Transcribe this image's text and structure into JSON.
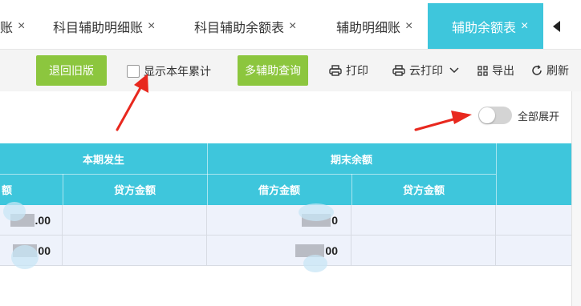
{
  "tabs": [
    {
      "label": "账",
      "close": "×"
    },
    {
      "label": "科目辅助明细账",
      "close": "×"
    },
    {
      "label": "科目辅助余额表",
      "close": "×"
    },
    {
      "label": "辅助明细账",
      "close": "×"
    },
    {
      "label": "辅助余额表",
      "close": "×",
      "active": true
    }
  ],
  "toolbar": {
    "back_label": "退回旧版",
    "show_cumulative_label": "显示本年累计",
    "multi_query_label": "多辅助查询",
    "print_label": "打印",
    "cloud_print_label": "云打印",
    "export_label": "导出",
    "refresh_label": "刷新"
  },
  "expand_all_label": "全部展开",
  "table": {
    "group_headers": {
      "current_period": "本期发生",
      "closing_balance": "期末余额"
    },
    "sub_headers": {
      "debit_partial": "额",
      "current_credit": "贷方金额",
      "closing_debit": "借方金额",
      "closing_credit": "贷方金额"
    },
    "rows": [
      {
        "current_debit_suffix": ".00",
        "closing_debit_suffix": "0"
      },
      {
        "current_debit_suffix": "00",
        "closing_debit_suffix": "00"
      }
    ]
  },
  "colors": {
    "tab_active": "#3ec6dc",
    "header_bg": "#3ec6dc",
    "button_green": "#8cc63e",
    "arrow_red": "#e8281e"
  }
}
